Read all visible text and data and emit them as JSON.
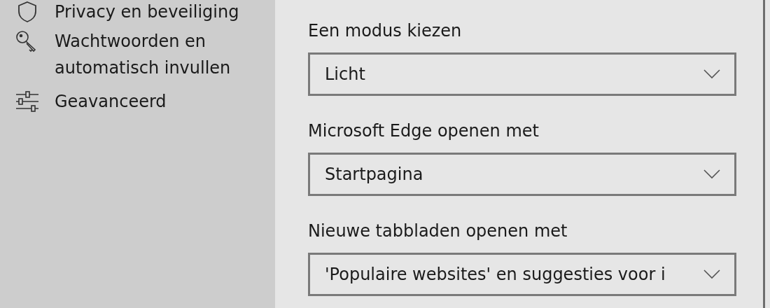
{
  "sidebar": {
    "items": [
      {
        "kind": "shield",
        "label": "Privacy en beveiliging",
        "selected": false
      },
      {
        "kind": "key",
        "label": "Wachtwoorden en automatisch invullen",
        "selected": false
      },
      {
        "kind": "sliders",
        "label": "Geavanceerd",
        "selected": false
      }
    ]
  },
  "settings": [
    {
      "label": "Een modus kiezen",
      "value": "Licht"
    },
    {
      "label": "Microsoft Edge openen met",
      "value": "Startpagina"
    },
    {
      "label": "Nieuwe tabbladen openen met",
      "value": "'Populaire websites' en suggesties voor i"
    }
  ]
}
